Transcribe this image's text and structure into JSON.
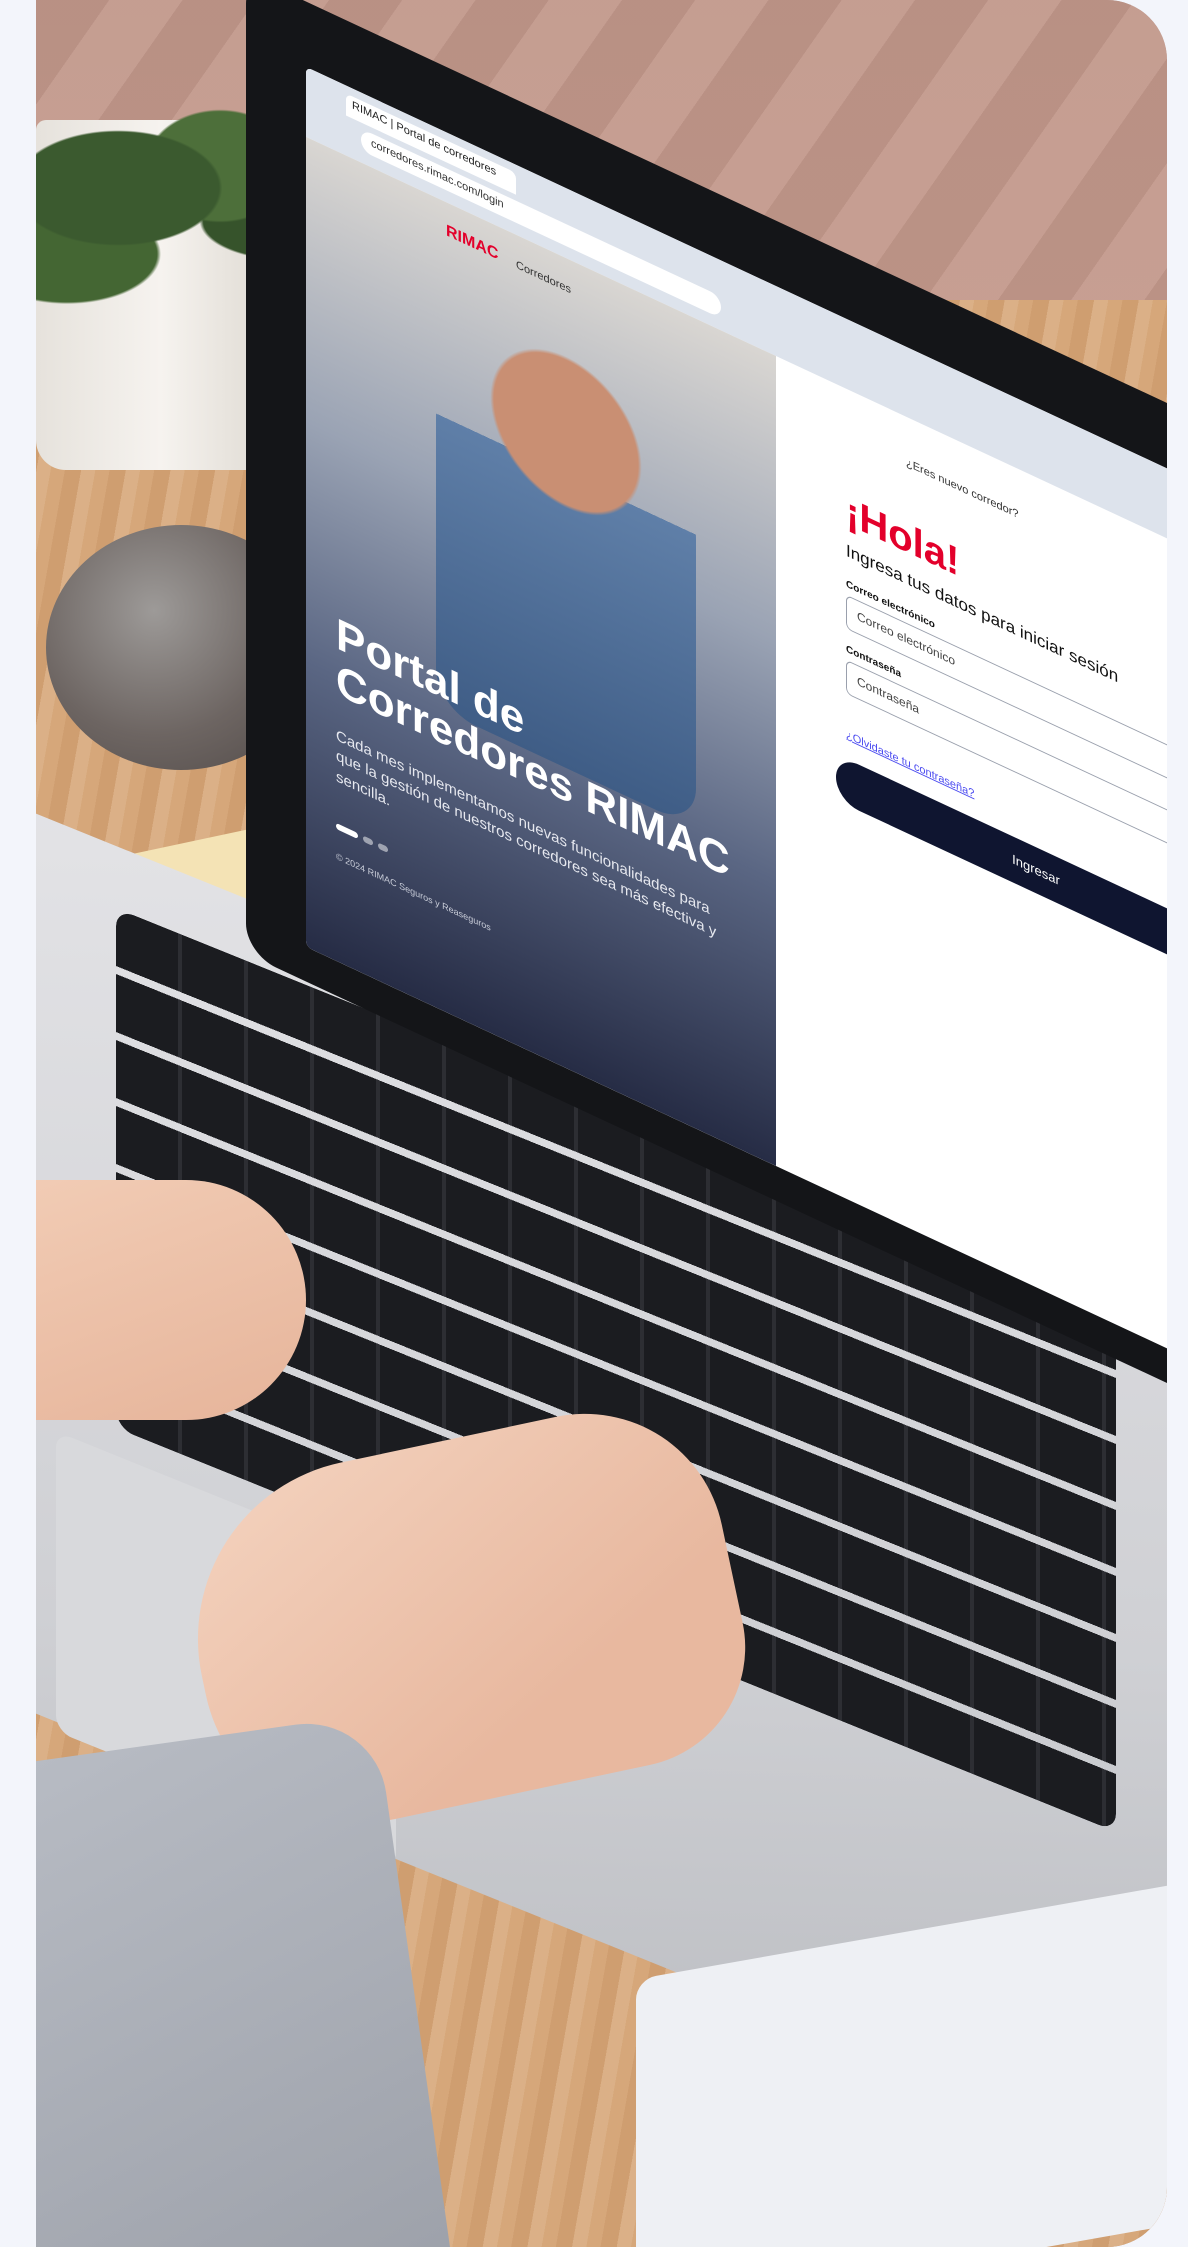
{
  "screen": {
    "browser": {
      "tab_title": "RIMAC | Portal de corredores",
      "url": "corredores.rimac.com/login"
    },
    "brand": {
      "logo_text": "RIMAC",
      "sub_label": "Corredores"
    },
    "hero": {
      "title": "Portal de Corredores RIMAC",
      "description": "Cada mes implementamos nuevas funcionalidades para que la gestión de nuestros corredores sea más efectiva y sencilla.",
      "copyright": "© 2024 RIMAC Seguros y Reaseguros"
    },
    "login": {
      "new_broker_text": "¿Eres nuevo corredor?",
      "greeting": "¡Hola!",
      "subtitle": "Ingresa tus datos para iniciar sesión",
      "email_label": "Correo electrónico",
      "email_placeholder": "Correo electrónico",
      "password_label": "Contraseña",
      "password_placeholder": "Contraseña",
      "forgot_link": "¿Olvidaste tu contraseña?",
      "submit_label": "Ingresar"
    }
  },
  "colors": {
    "brand_red": "#e3002b",
    "button_navy": "#0f1530",
    "background": "#f3f5fb"
  }
}
